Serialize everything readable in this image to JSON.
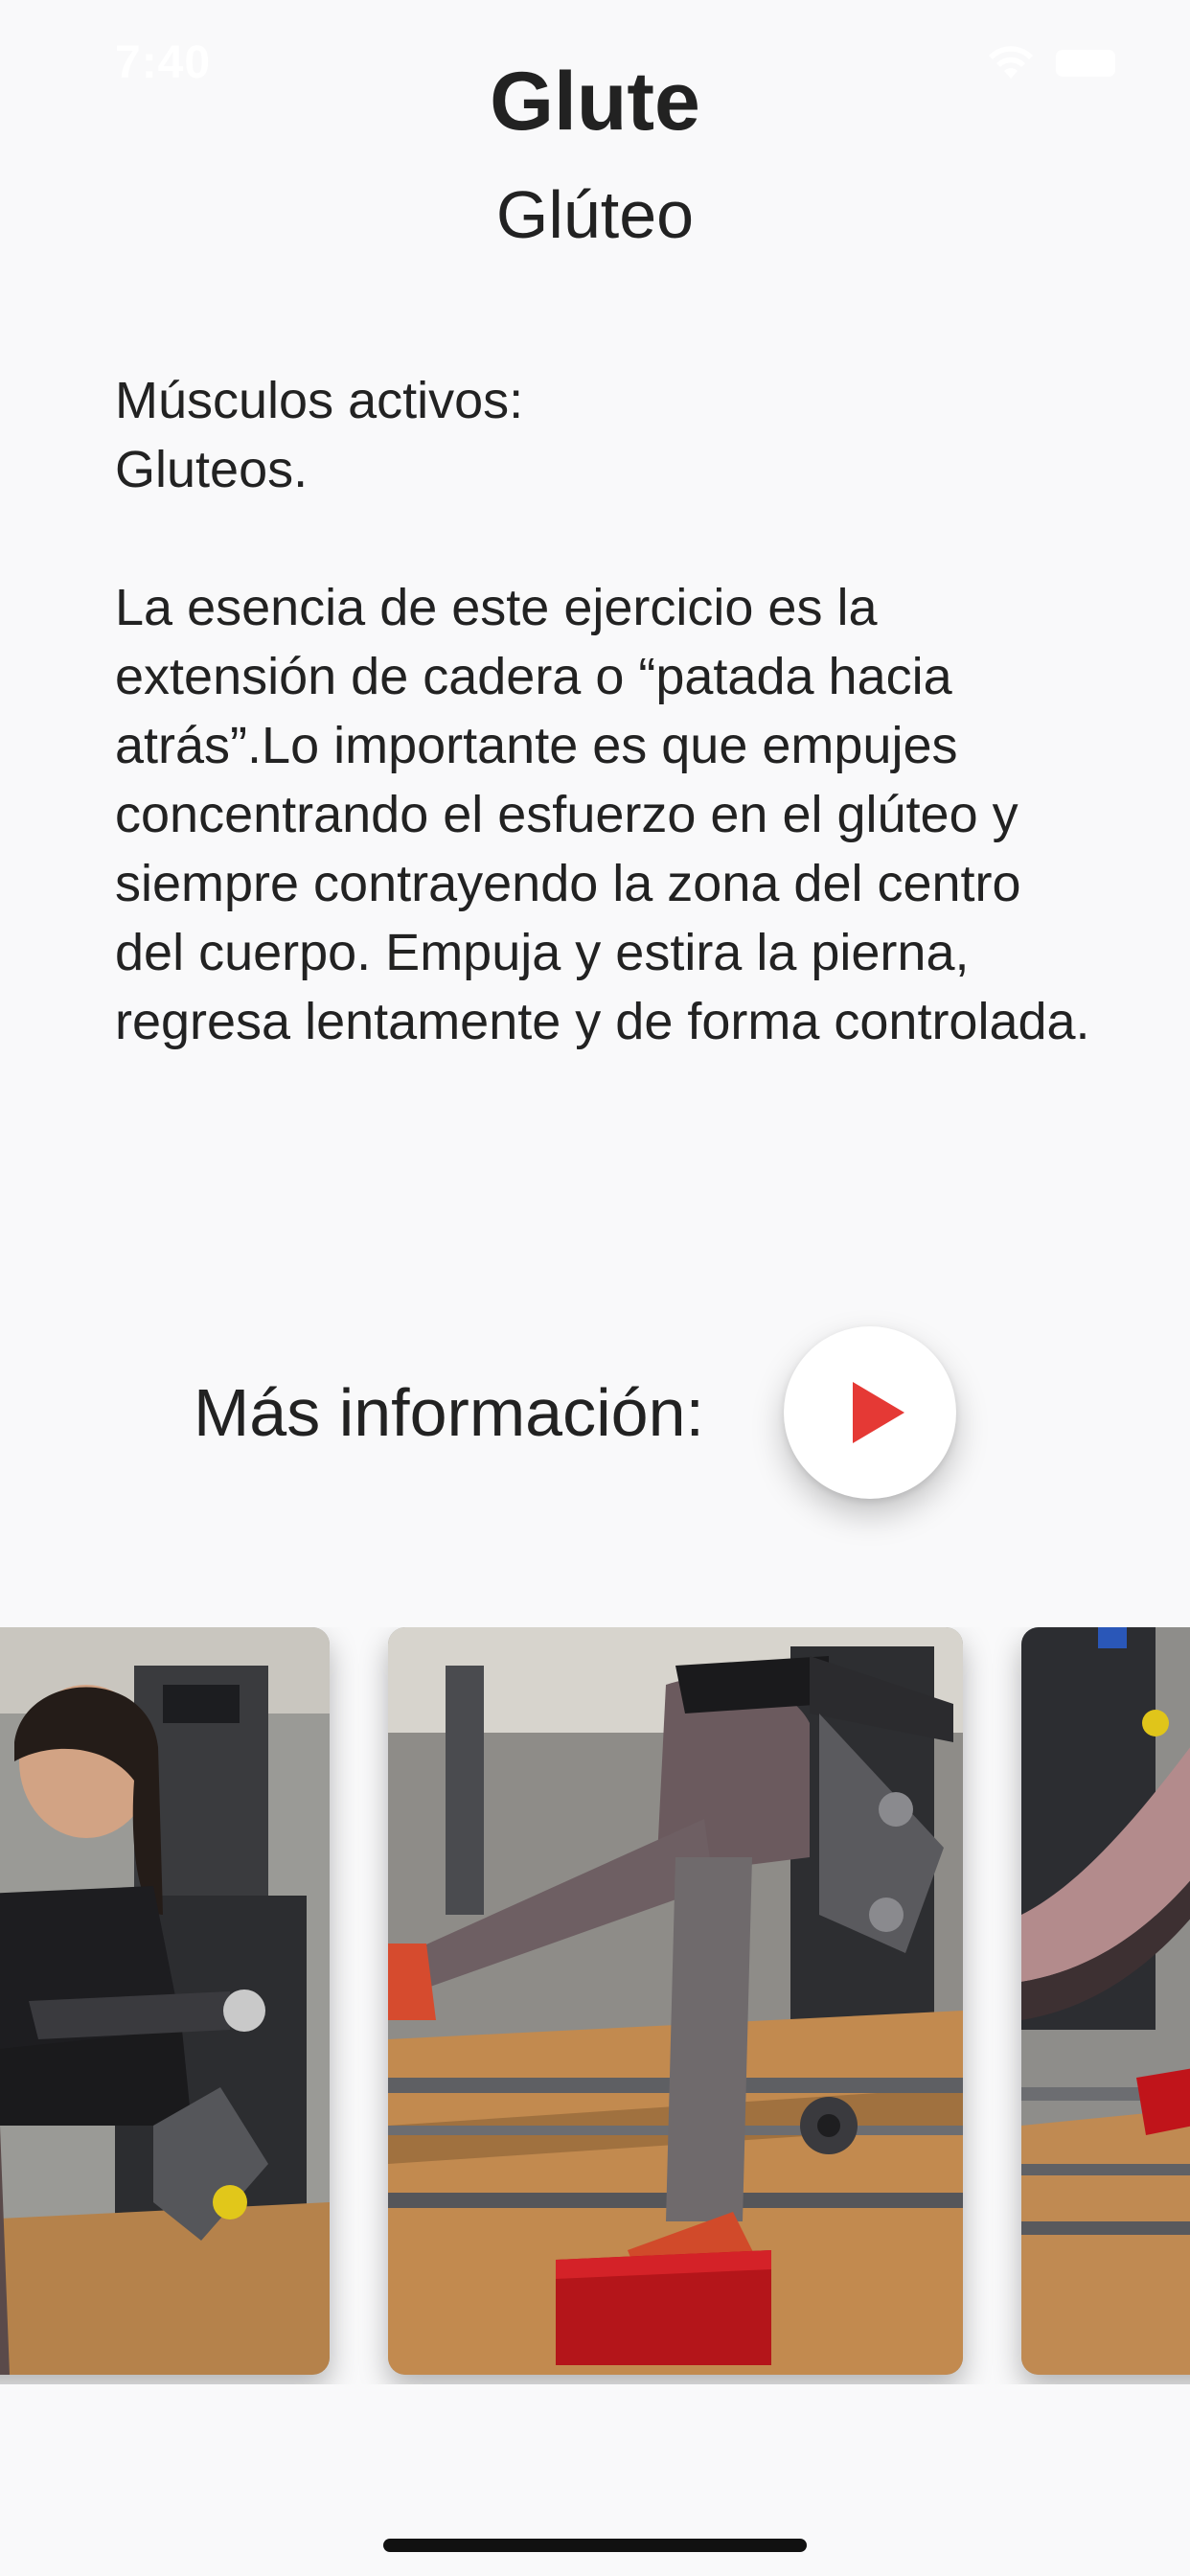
{
  "status_bar": {
    "time": "7:40",
    "icons": [
      "wifi-icon",
      "battery-icon"
    ]
  },
  "header": {
    "title": "Glute",
    "subtitle": "Glúteo"
  },
  "description": {
    "muscles_label": "Músculos activos:",
    "muscles_value": "Gluteos.",
    "body": "La esencia de este ejercicio es la extensión de cadera o “patada hacia atrás”.Lo importante es que empujes concentrando el esfuerzo en el glúteo y siempre contrayendo la zona del centro del cuerpo. Empuja y estira la pierna, regresa lentamente y de forma controlada."
  },
  "more_info": {
    "label": "Más información:",
    "button_icon": "play-icon"
  },
  "gallery": {
    "photos": [
      {
        "depicts": "woman-on-glute-machine"
      },
      {
        "depicts": "glute-kickback-leg-extension"
      },
      {
        "depicts": "glute-machine-closeup"
      }
    ]
  },
  "colors": {
    "background": "#f9f9fa",
    "text": "#222222",
    "play_accent": "#e53935",
    "button_bg": "#ffffff"
  }
}
